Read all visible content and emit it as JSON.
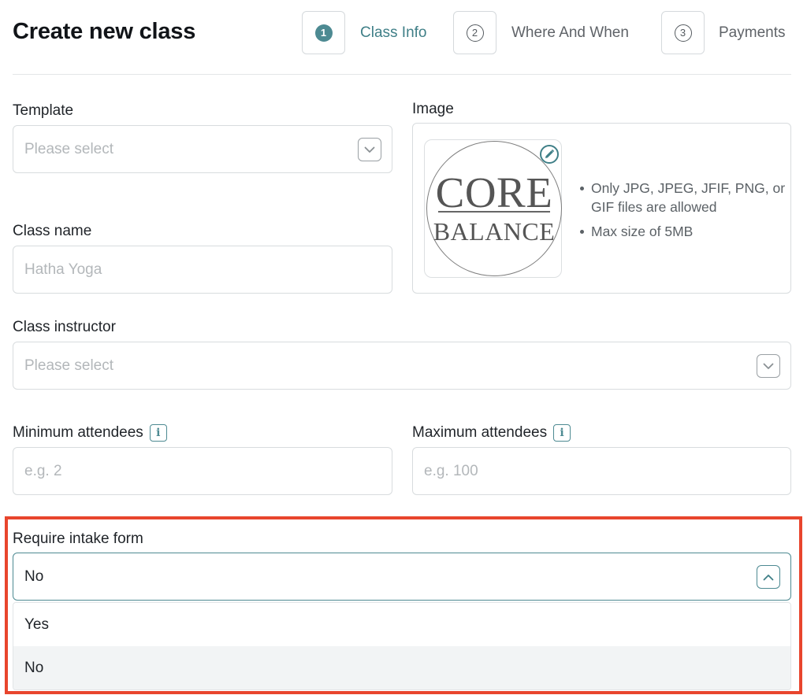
{
  "header": {
    "title": "Create new class",
    "steps": [
      {
        "number": "1",
        "label": "Class Info",
        "active": true
      },
      {
        "number": "2",
        "label": "Where And When",
        "active": false
      },
      {
        "number": "3",
        "label": "Payments",
        "active": false
      }
    ]
  },
  "form": {
    "template": {
      "label": "Template",
      "placeholder": "Please select",
      "icon": "chevron-down-icon"
    },
    "image": {
      "label": "Image",
      "logo_line1": "CORE",
      "logo_line2": "BALANCE",
      "hints": [
        "Only JPG, JPEG, JFIF, PNG, or GIF files are allowed",
        "Max size of 5MB"
      ],
      "edit_icon": "pencil-icon"
    },
    "class_name": {
      "label": "Class name",
      "placeholder": "Hatha Yoga"
    },
    "instructor": {
      "label": "Class instructor",
      "placeholder": "Please select",
      "icon": "chevron-down-icon"
    },
    "min_attendees": {
      "label": "Minimum attendees",
      "placeholder": "e.g. 2",
      "icon": "info-icon"
    },
    "max_attendees": {
      "label": "Maximum attendees",
      "placeholder": "e.g. 100",
      "icon": "info-icon"
    },
    "intake_form": {
      "label": "Require intake form",
      "value": "No",
      "icon": "chevron-up-icon",
      "options": [
        "Yes",
        "No"
      ],
      "selected": "No"
    }
  },
  "colors": {
    "accent": "#4d8a92",
    "highlight": "#e8452d",
    "border": "#d8dcde",
    "placeholder": "#b3b7ba"
  }
}
